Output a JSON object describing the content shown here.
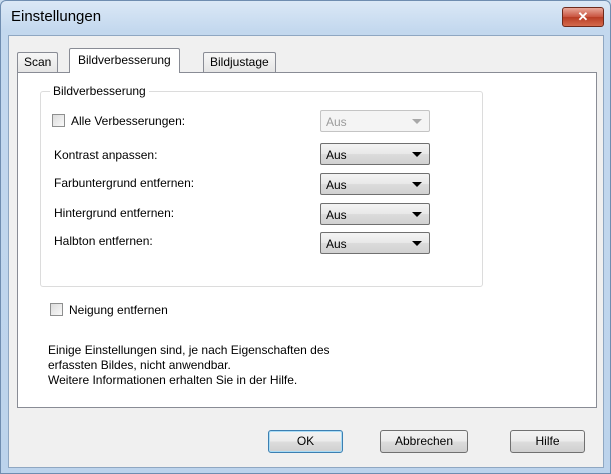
{
  "window": {
    "title": "Einstellungen",
    "close_glyph": "✕"
  },
  "tabs": [
    {
      "label": "Scan"
    },
    {
      "label": "Bildverbesserung",
      "active": true
    },
    {
      "label": "Bildjustage"
    }
  ],
  "group": {
    "legend": "Bildverbesserung",
    "all_improvements": {
      "label": "Alle Verbesserungen:",
      "checked": false,
      "value": "Aus",
      "enabled": false
    },
    "rows": [
      {
        "label": "Kontrast anpassen:",
        "value": "Aus"
      },
      {
        "label": "Farbuntergrund entfernen:",
        "value": "Aus"
      },
      {
        "label": "Hintergrund entfernen:",
        "value": "Aus"
      },
      {
        "label": "Halbton entfernen:",
        "value": "Aus"
      }
    ]
  },
  "deskew": {
    "label": "Neigung entfernen",
    "checked": false
  },
  "info_lines": [
    "Einige Einstellungen sind, je nach Eigenschaften des",
    "erfassten Bildes, nicht anwendbar.",
    "Weitere Informationen erhalten Sie in der Hilfe."
  ],
  "buttons": {
    "ok": "OK",
    "cancel": "Abbrechen",
    "help": "Hilfe"
  }
}
